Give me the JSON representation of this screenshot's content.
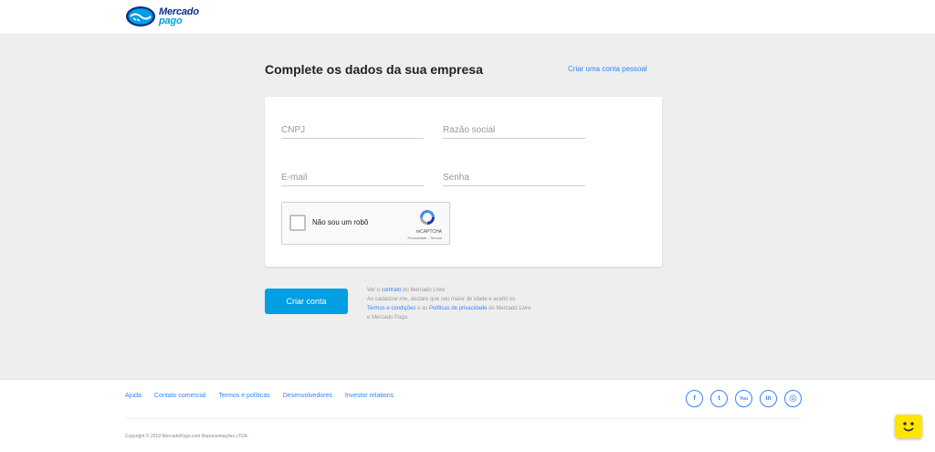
{
  "brand": {
    "line1": "Mercado",
    "line2": "pago"
  },
  "main": {
    "title": "Complete os dados da sua empresa",
    "personal_link": "Criar uma conta pessoal"
  },
  "form": {
    "cnpj_placeholder": "CNPJ",
    "razao_placeholder": "Razão social",
    "email_placeholder": "E-mail",
    "senha_placeholder": "Senha"
  },
  "captcha": {
    "label": "Não sou um robô",
    "brand": "reCAPTCHA",
    "terms": "Privacidade - Termos"
  },
  "actions": {
    "create_label": "Criar conta"
  },
  "legal": {
    "p1": "Ver o ",
    "contract_link": "contrato",
    "p2": " do Mercado Livre",
    "p3": "Ao cadastrar-me, declaro que sou maior de idade e aceito os",
    "terms_link": "Termos e condições",
    "p4": " e as ",
    "privacy_link": "Políticas de privacidade",
    "p5": " do Mercado Livre",
    "p6": "e Mercado Pago."
  },
  "footer": {
    "links": [
      "Ajuda",
      "Contato comercial",
      "Termos e políticas",
      "Desenvolvedores",
      "Investor relations"
    ],
    "social": [
      {
        "name": "facebook-icon",
        "glyph": "f"
      },
      {
        "name": "twitter-icon",
        "glyph": "t"
      },
      {
        "name": "youtube-icon",
        "glyph": "You"
      },
      {
        "name": "linkedin-icon",
        "glyph": "in"
      },
      {
        "name": "instagram-icon",
        "glyph": "◎"
      }
    ],
    "copyright": "Copyright © 2019 MercadoPago.com Representações LTDA."
  },
  "colors": {
    "accent": "#009ee3",
    "link": "#3483fa",
    "background": "#eeeeee",
    "help_widget": "#ffe600"
  }
}
